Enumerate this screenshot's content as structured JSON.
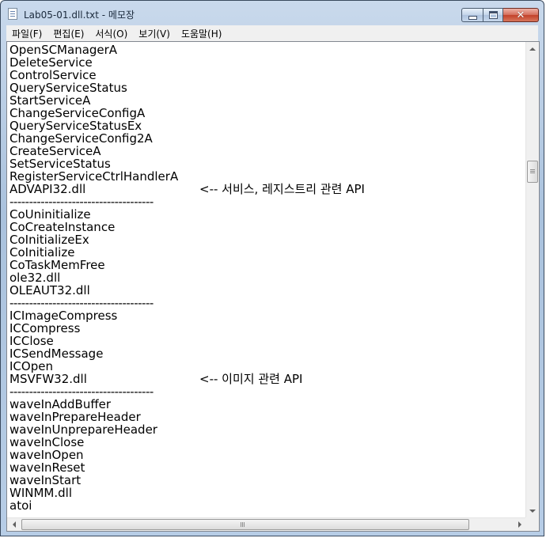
{
  "window": {
    "title": "Lab05-01.dll.txt - 메모장",
    "close_glyph": "✕"
  },
  "menu": {
    "items": [
      "파일(F)",
      "편집(E)",
      "서식(O)",
      "보기(V)",
      "도움말(H)"
    ]
  },
  "document": {
    "lines": [
      "OpenSCManagerA",
      "DeleteService",
      "ControlService",
      "QueryServiceStatus",
      "StartServiceA",
      "ChangeServiceConfigA",
      "QueryServiceStatusEx",
      "ChangeServiceConfig2A",
      "CreateServiceA",
      "SetServiceStatus",
      "RegisterServiceCtrlHandlerA",
      "ADVAPI32.dll",
      "-------------------------------------",
      "CoUninitialize",
      "CoCreateInstance",
      "CoInitializeEx",
      "CoInitialize",
      "CoTaskMemFree",
      "ole32.dll",
      "OLEAUT32.dll",
      "-------------------------------------",
      "ICImageCompress",
      "ICCompress",
      "ICClose",
      "ICSendMessage",
      "ICOpen",
      "MSVFW32.dll",
      "-------------------------------------",
      "waveInAddBuffer",
      "waveInPrepareHeader",
      "waveInUnprepareHeader",
      "waveInClose",
      "waveInOpen",
      "waveInReset",
      "waveInStart",
      "WINMM.dll",
      "atoi"
    ],
    "annotations": [
      {
        "line": 11,
        "text": "<-- 서비스, 레지스트리 관련 API"
      },
      {
        "line": 26,
        "text": "<-- 이미지 관련 API"
      }
    ]
  }
}
